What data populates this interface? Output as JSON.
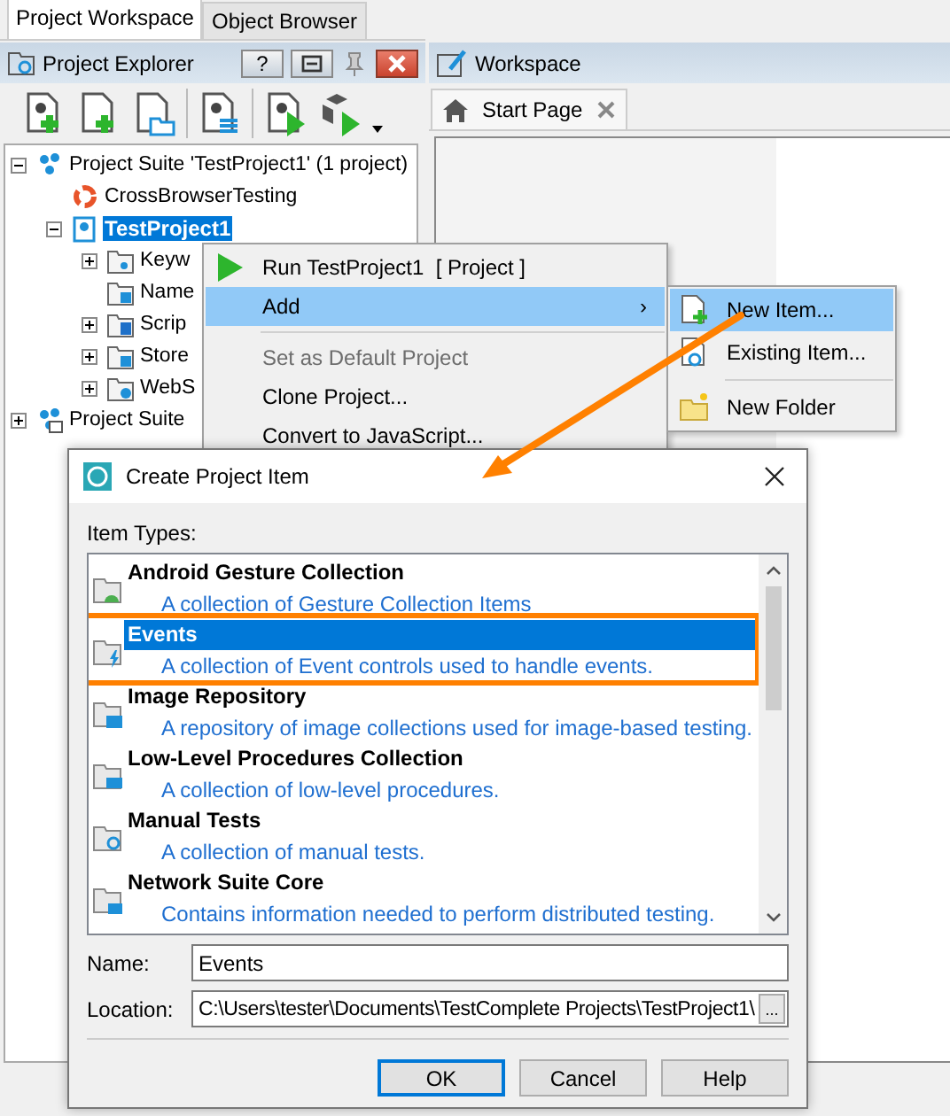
{
  "workspace_tabs": [
    {
      "label": "Project Workspace",
      "selected": true
    },
    {
      "label": "Object Browser",
      "selected": false
    }
  ],
  "explorer": {
    "title": "Project Explorer",
    "help_button": "?"
  },
  "tree": [
    {
      "kind": "suite",
      "label": "Project Suite 'TestProject1' (1 project)",
      "expanded": true,
      "selected": false,
      "children": [
        {
          "kind": "service",
          "label": "CrossBrowserTesting",
          "selected": false
        },
        {
          "kind": "project",
          "label": "TestProject1",
          "expanded": true,
          "selected": true,
          "children": [
            {
              "kind": "keywords",
              "label": "Keyw",
              "expanded": false,
              "selected": false
            },
            {
              "kind": "mapping",
              "label": "Name",
              "selected": false
            },
            {
              "kind": "scripts",
              "label": "Scrip",
              "expanded": false,
              "selected": false
            },
            {
              "kind": "stores",
              "label": "Store",
              "expanded": false,
              "selected": false
            },
            {
              "kind": "web",
              "label": "WebS",
              "expanded": false,
              "selected": false
            }
          ]
        }
      ]
    },
    {
      "kind": "suite-check",
      "label": "Project Suite",
      "expanded": false,
      "selected": false
    }
  ],
  "workspace": {
    "title": "Workspace",
    "tab": {
      "label": "Start Page",
      "selected": true
    }
  },
  "context_menu": [
    {
      "kind": "run",
      "label": "Run TestProject1  [ Project ]",
      "selected": false,
      "disabled": false
    },
    {
      "kind": "submenu",
      "label": "Add",
      "arrow": "›",
      "selected": true,
      "disabled": false
    },
    {
      "kind": "separator"
    },
    {
      "kind": "command",
      "label": "Set as Default Project",
      "selected": false,
      "disabled": true
    },
    {
      "kind": "command",
      "label": "Clone Project...",
      "selected": false,
      "disabled": false
    },
    {
      "kind": "command",
      "label": "Convert to JavaScript...",
      "selected": false,
      "disabled": false
    }
  ],
  "submenu": [
    {
      "kind": "new-item",
      "label": "New Item...",
      "selected": true
    },
    {
      "kind": "existing-item",
      "label": "Existing Item...",
      "selected": false
    },
    {
      "kind": "separator"
    },
    {
      "kind": "new-folder",
      "label": "New Folder",
      "selected": false
    }
  ],
  "dialog": {
    "title": "Create Project Item",
    "list_label": "Item Types:",
    "items": [
      {
        "kind": "android",
        "title": "Android Gesture Collection",
        "description": "A collection of Gesture Collection Items",
        "selected": false,
        "callout": false
      },
      {
        "kind": "events",
        "title": "Events",
        "description": "A collection of Event controls used to handle events.",
        "selected": true,
        "callout": true
      },
      {
        "kind": "image",
        "title": "Image Repository",
        "description": "A repository of image collections used for image-based testing.",
        "selected": false,
        "callout": false
      },
      {
        "kind": "lowlevel",
        "title": "Low-Level Procedures Collection",
        "description": "A collection of low-level procedures.",
        "selected": false,
        "callout": false
      },
      {
        "kind": "manual",
        "title": "Manual Tests",
        "description": "A collection of manual tests.",
        "selected": false,
        "callout": false
      },
      {
        "kind": "network",
        "title": "Network Suite Core",
        "description": "Contains information needed to perform distributed testing.",
        "selected": false,
        "callout": false
      }
    ],
    "name": {
      "label": "Name:",
      "value": "Events"
    },
    "location": {
      "label": "Location:",
      "value": "C:\\Users\\tester\\Documents\\TestComplete Projects\\TestProject1\\",
      "browse": "..."
    },
    "buttons": [
      {
        "label": "OK",
        "default": true
      },
      {
        "label": "Cancel",
        "default": false
      },
      {
        "label": "Help",
        "default": false
      }
    ]
  }
}
